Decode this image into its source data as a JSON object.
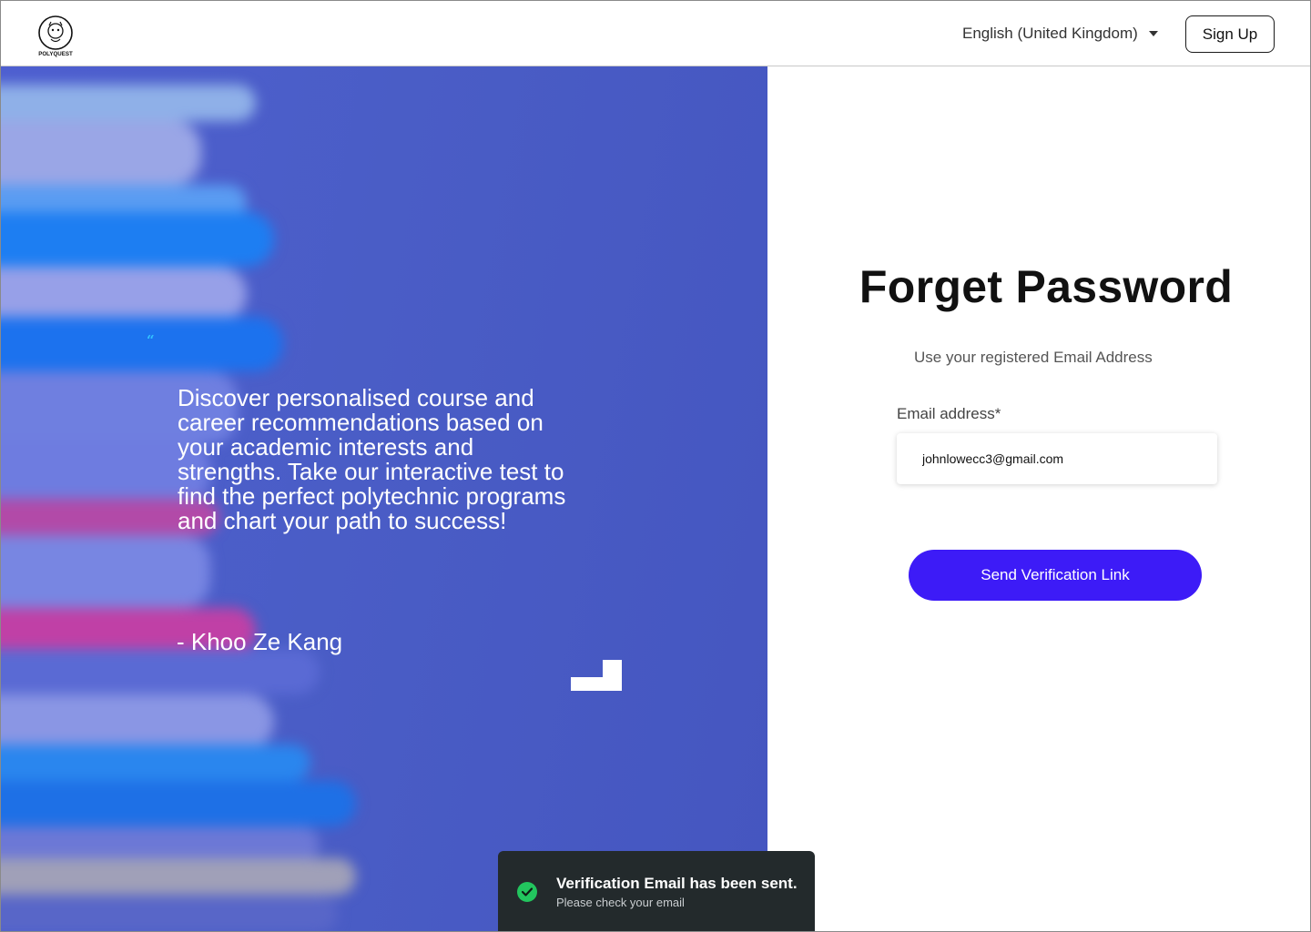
{
  "header": {
    "logo_text": "POLYQUEST",
    "language": "English (United Kingdom)",
    "signup_label": "Sign Up"
  },
  "hero": {
    "quote_mark": "“",
    "quote": "Discover personalised course and career recommendations based on your academic interests and strengths. Take our interactive test to find the perfect polytechnic programs and chart your path to success!",
    "author": "- Khoo Ze Kang"
  },
  "form": {
    "title": "Forget Password",
    "subtitle": "Use your registered Email Address",
    "email_label": "Email address*",
    "email_value": "johnlowecc3@gmail.com",
    "submit_label": "Send Verification Link"
  },
  "toast": {
    "title": "Verification Email has been sent.",
    "message": "Please check your email",
    "status_icon": "check-circle-icon"
  },
  "colors": {
    "primary_button": "#3d1bf7",
    "hero_background": "#4a5dc6",
    "quote_mark": "#33c3ff",
    "toast_background": "#232a2c",
    "success": "#22c55e"
  }
}
